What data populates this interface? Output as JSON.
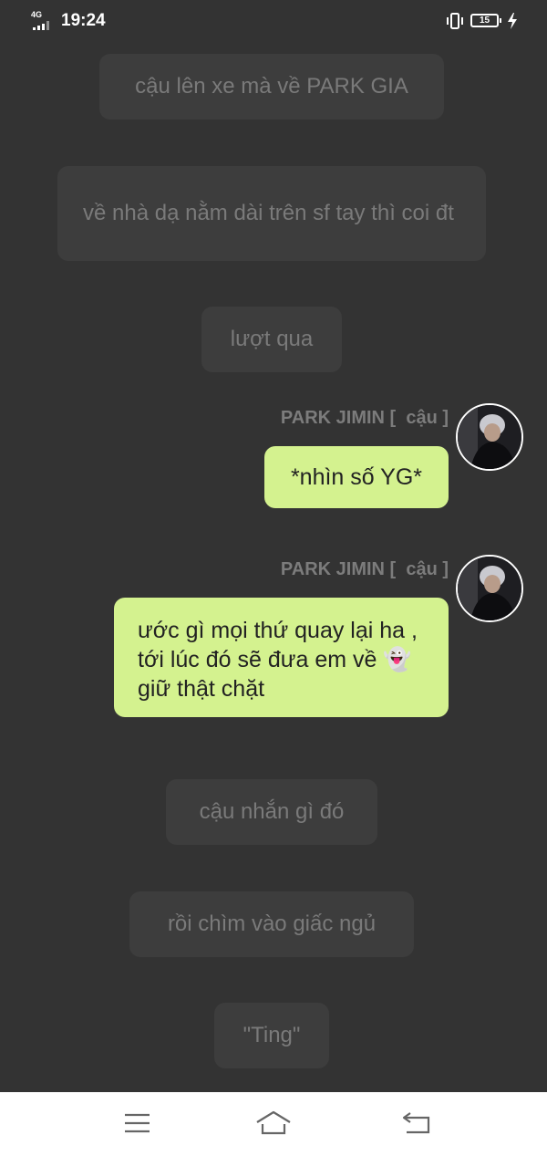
{
  "status_bar": {
    "network": "4G",
    "time": "19:24",
    "battery": "15"
  },
  "messages": {
    "narration_1": "cậu lên xe mà về PARK GIA",
    "narration_2": "về nhà dạ nằm dài trên sf tay thì coi đt",
    "narration_3": "lượt qua",
    "speaker_1": "PARK JIMIN [  cậu ]",
    "bubble_1": "*nhìn số YG*",
    "speaker_2": "PARK JIMIN [  cậu ]",
    "bubble_2_text": "ước gì mọi thứ quay lại ha , tới lúc đó  sẽ đưa em về",
    "bubble_2_emoji": "👻",
    "bubble_2_tail": "giữ thật chặt",
    "narration_4": "cậu nhắn gì đó",
    "narration_5": "rồi chìm vào giấc ngủ",
    "narration_6": "\"Ting\""
  },
  "colors": {
    "background": "#333333",
    "narration_bubble": "#3d3d3d",
    "chat_bubble": "#d4f28f",
    "nav_bar": "#ffffff"
  },
  "icons": {
    "status": [
      "signal-icon",
      "vibrate-icon",
      "battery-icon",
      "charging-icon"
    ],
    "nav": [
      "menu-icon",
      "home-icon",
      "back-icon"
    ]
  }
}
